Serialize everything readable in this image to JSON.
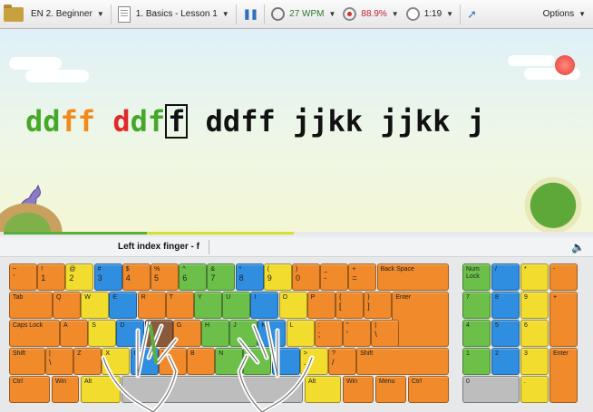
{
  "toolbar": {
    "course": "EN 2. Beginner",
    "lesson": "1. Basics - Lesson 1",
    "wpm": "27 WPM",
    "accuracy": "88.9%",
    "time": "1:19",
    "options": "Options"
  },
  "lesson_text": {
    "segments": [
      {
        "text": "dd",
        "color": "green"
      },
      {
        "text": "ff",
        "color": "orange"
      },
      {
        "text": " ",
        "color": "black"
      },
      {
        "text": "d",
        "color": "red"
      },
      {
        "text": "df",
        "color": "green"
      },
      {
        "text": "f",
        "color": "cursor"
      },
      {
        "text": " ddff jjkk jjkk j",
        "color": "black"
      }
    ]
  },
  "hint": "Left index finger - f",
  "keyboard": {
    "main": [
      {
        "label": "~",
        "sub": "`",
        "color": "orange"
      },
      {
        "label": "!",
        "sub": "1",
        "color": "orange"
      },
      {
        "label": "@",
        "sub": "2",
        "color": "yellow"
      },
      {
        "label": "#",
        "sub": "3",
        "color": "blue"
      },
      {
        "label": "$",
        "sub": "4",
        "color": "orange"
      },
      {
        "label": "%",
        "sub": "5",
        "color": "orange"
      },
      {
        "label": "^",
        "sub": "6",
        "color": "green"
      },
      {
        "label": "&",
        "sub": "7",
        "color": "green"
      },
      {
        "label": "*",
        "sub": "8",
        "color": "blue"
      },
      {
        "label": "(",
        "sub": "9",
        "color": "yellow"
      },
      {
        "label": ")",
        "sub": "0",
        "color": "orange"
      },
      {
        "label": "_",
        "sub": "-",
        "color": "orange"
      },
      {
        "label": "+",
        "sub": "=",
        "color": "orange"
      },
      {
        "label": "Back Space",
        "sub": "",
        "color": "orange"
      },
      {
        "label": "Tab",
        "sub": "",
        "color": "orange"
      },
      {
        "label": "Q",
        "sub": "",
        "color": "orange"
      },
      {
        "label": "W",
        "sub": "",
        "color": "yellow"
      },
      {
        "label": "E",
        "sub": "",
        "color": "blue"
      },
      {
        "label": "R",
        "sub": "",
        "color": "orange"
      },
      {
        "label": "T",
        "sub": "",
        "color": "orange"
      },
      {
        "label": "Y",
        "sub": "",
        "color": "green"
      },
      {
        "label": "U",
        "sub": "",
        "color": "green"
      },
      {
        "label": "I",
        "sub": "",
        "color": "blue"
      },
      {
        "label": "O",
        "sub": "",
        "color": "yellow"
      },
      {
        "label": "P",
        "sub": "",
        "color": "orange"
      },
      {
        "label": "{",
        "sub": "[",
        "color": "orange"
      },
      {
        "label": "}",
        "sub": "]",
        "color": "orange"
      },
      {
        "label": "Enter",
        "sub": "",
        "color": "orange"
      },
      {
        "label": "Caps Lock",
        "sub": "",
        "color": "orange"
      },
      {
        "label": "A",
        "sub": "",
        "color": "orange"
      },
      {
        "label": "S",
        "sub": "",
        "color": "yellow"
      },
      {
        "label": "D",
        "sub": "",
        "color": "blue"
      },
      {
        "label": "F",
        "sub": "",
        "color": "brown"
      },
      {
        "label": "G",
        "sub": "",
        "color": "orange"
      },
      {
        "label": "H",
        "sub": "",
        "color": "green"
      },
      {
        "label": "J",
        "sub": "",
        "color": "green"
      },
      {
        "label": "K",
        "sub": "",
        "color": "blue"
      },
      {
        "label": "L",
        "sub": "",
        "color": "yellow"
      },
      {
        "label": ":",
        "sub": ";",
        "color": "orange"
      },
      {
        "label": "\"",
        "sub": "'",
        "color": "orange"
      },
      {
        "label": "|",
        "sub": "\\",
        "color": "orange"
      },
      {
        "label": "Shift",
        "sub": "",
        "color": "orange"
      },
      {
        "label": "|",
        "sub": "\\",
        "color": "orange"
      },
      {
        "label": "Z",
        "sub": "",
        "color": "orange"
      },
      {
        "label": "X",
        "sub": "",
        "color": "yellow"
      },
      {
        "label": "C",
        "sub": "",
        "color": "blue"
      },
      {
        "label": "V",
        "sub": "",
        "color": "orange"
      },
      {
        "label": "B",
        "sub": "",
        "color": "orange"
      },
      {
        "label": "N",
        "sub": "",
        "color": "green"
      },
      {
        "label": "M",
        "sub": "",
        "color": "green"
      },
      {
        "label": "<",
        "sub": ",",
        "color": "blue"
      },
      {
        "label": ">",
        "sub": ".",
        "color": "yellow"
      },
      {
        "label": "?",
        "sub": "/",
        "color": "orange"
      },
      {
        "label": "Shift",
        "sub": "",
        "color": "orange"
      },
      {
        "label": "Ctrl",
        "sub": "",
        "color": "orange"
      },
      {
        "label": "Win",
        "sub": "",
        "color": "orange"
      },
      {
        "label": "Alt",
        "sub": "",
        "color": "yellow"
      },
      {
        "label": "",
        "sub": "",
        "color": "gray"
      },
      {
        "label": "Alt",
        "sub": "",
        "color": "yellow"
      },
      {
        "label": "Win",
        "sub": "",
        "color": "orange"
      },
      {
        "label": "Menu",
        "sub": "",
        "color": "orange"
      },
      {
        "label": "Ctrl",
        "sub": "",
        "color": "orange"
      }
    ],
    "numpad": [
      {
        "label": "Num Lock",
        "sub": "",
        "color": "green"
      },
      {
        "label": "/",
        "sub": "",
        "color": "blue"
      },
      {
        "label": "*",
        "sub": "",
        "color": "yellow"
      },
      {
        "label": "-",
        "sub": "",
        "color": "orange"
      },
      {
        "label": "7",
        "sub": "",
        "color": "green"
      },
      {
        "label": "8",
        "sub": "",
        "color": "blue"
      },
      {
        "label": "9",
        "sub": "",
        "color": "yellow"
      },
      {
        "label": "+",
        "sub": "",
        "color": "orange"
      },
      {
        "label": "4",
        "sub": "",
        "color": "green"
      },
      {
        "label": "5",
        "sub": "",
        "color": "blue"
      },
      {
        "label": "6",
        "sub": "",
        "color": "yellow"
      },
      {
        "label": "1",
        "sub": "",
        "color": "green"
      },
      {
        "label": "2",
        "sub": "",
        "color": "blue"
      },
      {
        "label": "3",
        "sub": "",
        "color": "yellow"
      },
      {
        "label": "Enter",
        "sub": "",
        "color": "orange"
      },
      {
        "label": "0",
        "sub": "",
        "color": "gray"
      },
      {
        "label": ".",
        "sub": "",
        "color": "yellow"
      }
    ]
  },
  "colors": {
    "green": "#6cc04a",
    "orange": "#f08a2a",
    "yellow": "#f2dc2e",
    "blue": "#2f8ee0",
    "brown": "#8a5a3a",
    "gray": "#bdbdbd"
  }
}
